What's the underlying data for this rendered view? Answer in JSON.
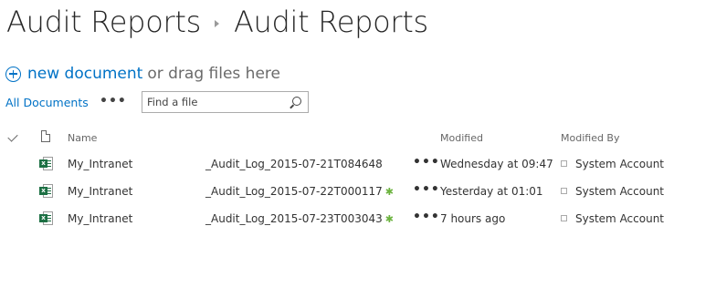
{
  "breadcrumb": {
    "parent": "Audit Reports",
    "current": "Audit Reports"
  },
  "toolbar": {
    "new_document": "new document",
    "drag_hint": "or drag files here"
  },
  "views": {
    "current": "All Documents",
    "more": "•••"
  },
  "search": {
    "placeholder": "Find a file"
  },
  "columns": {
    "name": "Name",
    "modified": "Modified",
    "modified_by": "Modified By"
  },
  "rows": [
    {
      "name_part1": "My_Intranet",
      "name_part2": "_Audit_Log_2015-07-21T084648",
      "is_new": false,
      "modified": "Wednesday at 09:47",
      "modified_by": "System Account"
    },
    {
      "name_part1": "My_Intranet",
      "name_part2": "_Audit_Log_2015-07-22T000117",
      "is_new": true,
      "modified": "Yesterday at 01:01",
      "modified_by": "System Account"
    },
    {
      "name_part1": "My_Intranet",
      "name_part2": "_Audit_Log_2015-07-23T003043",
      "is_new": true,
      "modified": "7 hours ago",
      "modified_by": "System Account"
    }
  ],
  "icons": {
    "new_badge": "✱",
    "file_type": "excel-file-icon",
    "excel_letter": "x"
  },
  "colors": {
    "accent": "#0072c6",
    "excel_green": "#1d7044",
    "new_green": "#6cb33f"
  }
}
